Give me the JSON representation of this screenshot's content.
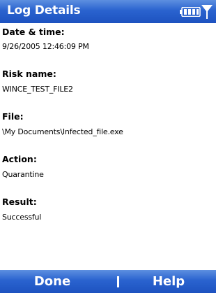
{
  "title_bar": {
    "title": "Log Details",
    "icons": [
      "battery-icon",
      "signal-icon"
    ]
  },
  "details": {
    "date_time_label": "Date & time:",
    "date_time_value": "9/26/2005 12:46:09 PM",
    "risk_name_label": "Risk name:",
    "risk_name_value": "WINCE_TEST_FILE2",
    "file_label": "File:",
    "file_value": "\\My Documents\\Infected_file.exe",
    "action_label": "Action:",
    "action_value": "Quarantine",
    "result_label": "Result:",
    "result_value": "Successful"
  },
  "menu_bar": {
    "left_softkey": "Done",
    "right_softkey": "Help"
  },
  "colors": {
    "bar_blue": "#2a63cf",
    "text": "#000000",
    "background": "#ffffff"
  }
}
